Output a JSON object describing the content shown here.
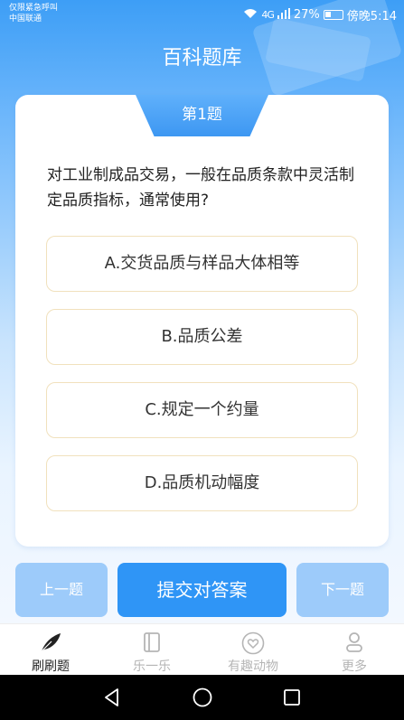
{
  "status_bar": {
    "carrier_line1": "仅限紧急呼叫",
    "carrier_line2": "中国联通",
    "signal": "4G",
    "battery": "27%",
    "time": "傍晚5:14"
  },
  "header": {
    "title": "百科题库"
  },
  "quiz": {
    "number_label": "第1题",
    "question": "对工业制成品交易，一般在品质条款中灵活制定品质指标，通常使用?",
    "options": [
      {
        "label": "A.交货品质与样品大体相等"
      },
      {
        "label": "B.品质公差"
      },
      {
        "label": "C.规定一个约量"
      },
      {
        "label": "D.品质机动幅度"
      }
    ]
  },
  "actions": {
    "prev_label": "上一题",
    "submit_label": "提交对答案",
    "next_label": "下一题"
  },
  "tabs": [
    {
      "label": "刷刷题",
      "icon": "feather-icon",
      "active": true
    },
    {
      "label": "乐一乐",
      "icon": "book-icon",
      "active": false
    },
    {
      "label": "有趣动物",
      "icon": "heart-icon",
      "active": false
    },
    {
      "label": "更多",
      "icon": "person-icon",
      "active": false
    }
  ],
  "colors": {
    "primary": "#2f95f6",
    "disabled_button": "#9dcbfa",
    "option_border": "#f1e1bd"
  }
}
